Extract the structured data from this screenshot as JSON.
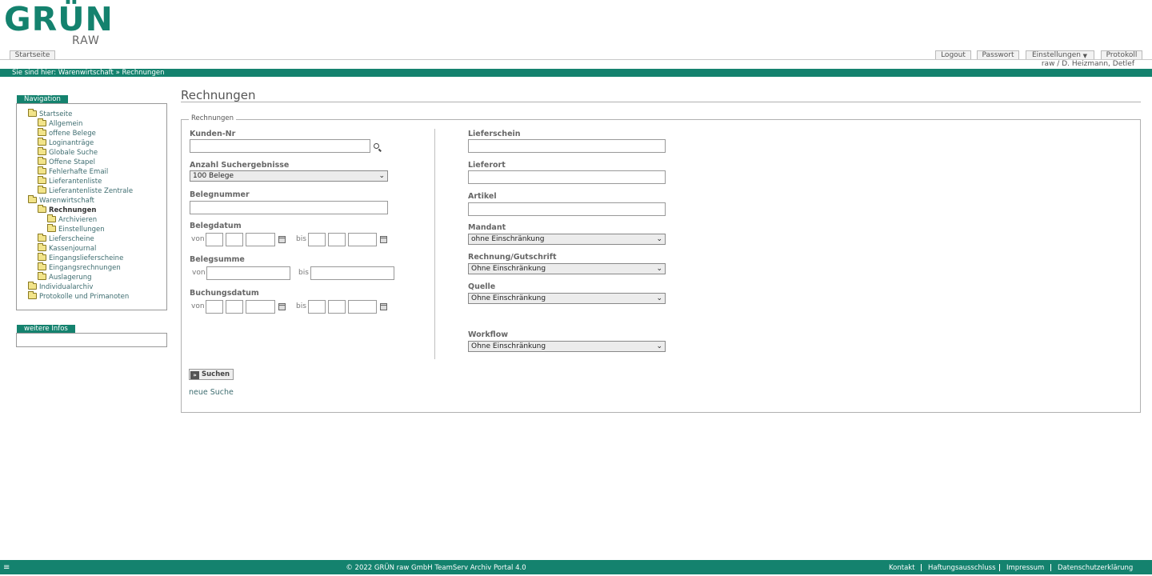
{
  "brand": {
    "logo": "GRÜN",
    "sub": "RAW"
  },
  "tabs": {
    "home": "Startseite"
  },
  "topnav": {
    "logout": "Logout",
    "password": "Passwort",
    "settings": "Einstellungen",
    "log": "Protokoll"
  },
  "user": "raw / D. Heizmann, Detlef",
  "breadcrumb": "Sie sind hier: Warenwirtschaft » Rechnungen",
  "sidebar": {
    "nav_title": "Navigation",
    "items": [
      "Startseite",
      "Allgemein",
      "offene Belege",
      "Loginanträge",
      "Globale Suche",
      "Offene Stapel",
      "Fehlerhafte Email",
      "Lieferantenliste",
      "Lieferantenliste Zentrale",
      "Warenwirtschaft",
      "Rechnungen",
      "Archivieren",
      "Einstellungen",
      "Lieferscheine",
      "Kassenjournal",
      "Eingangslieferscheine",
      "Eingangsrechnungen",
      "Auslagerung",
      "Individualarchiv",
      "Protokolle und Primanoten"
    ],
    "info_title": "weitere Infos"
  },
  "main": {
    "title": "Rechnungen",
    "legend": "Rechnungen",
    "left": {
      "kunden_nr": "Kunden-Nr",
      "anzahl": "Anzahl Suchergebnisse",
      "anzahl_value": "100 Belege",
      "belegnummer": "Belegnummer",
      "belegdatum": "Belegdatum",
      "belegsumme": "Belegsumme",
      "buchungsdatum": "Buchungsdatum",
      "von": "von",
      "bis": "bis"
    },
    "right": {
      "lieferschein": "Lieferschein",
      "lieferort": "Lieferort",
      "artikel": "Artikel",
      "mandant": "Mandant",
      "mandant_value": "ohne Einschränkung",
      "rechnung": "Rechnung/Gutschrift",
      "rechnung_value": "Ohne Einschränkung",
      "quelle": "Quelle",
      "quelle_value": "Ohne Einschränkung",
      "workflow": "Workflow",
      "workflow_value": "Ohne Einschränkung"
    },
    "search_button": "Suchen",
    "new_search": "neue Suche"
  },
  "footer": {
    "menu_icon": "≡",
    "copyright": "© 2022 GRÜN raw GmbH TeamServ Archiv Portal 4.0",
    "links": [
      "Kontakt",
      "Haftungsausschluss",
      "Impressum",
      "Datenschutzerklärung"
    ]
  },
  "colors": {
    "brand": "#14826e"
  }
}
